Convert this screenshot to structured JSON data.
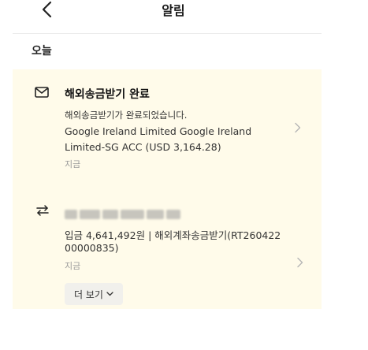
{
  "header": {
    "title": "알림"
  },
  "section_label": "오늘",
  "notifications": [
    {
      "icon": "mail-icon",
      "title": "해외송금받기 완료",
      "message_1": "해외송금받기가 완료되었습니다.",
      "message_2": "Google Ireland Limited Google Ireland",
      "message_3": "Limited-SG ACC (USD 3,164.28)",
      "time": "지금"
    },
    {
      "icon": "transfer-icon",
      "detail_1": "입금 4,641,492원 | 해외계좌송금받기(RT260422",
      "detail_2": "00000835)",
      "time": "지금",
      "more_label": "더 보기"
    }
  ],
  "colors": {
    "card_background": "#fffbea",
    "more_button_background": "#f1f0ec",
    "muted_text": "#9a9a9a"
  }
}
